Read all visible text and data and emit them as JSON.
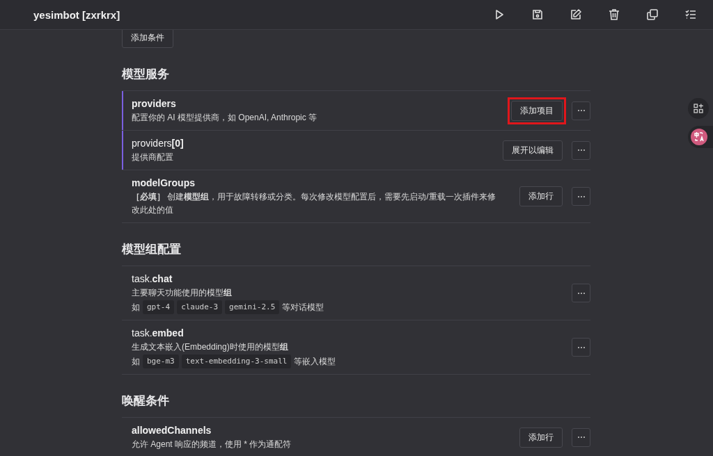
{
  "header": {
    "title": "yesimbot [zxrkrx]"
  },
  "top_button": "添加条件",
  "sections": [
    {
      "title": "模型服务",
      "rows": [
        {
          "name": "**providers**",
          "description": "配置你的 AI 模型提供商，如 OpenAI, Anthropic 等",
          "accent": true,
          "action": "添加项目",
          "highlighted": true
        },
        {
          "name": "providers**[0]**",
          "description": "提供商配置",
          "accent": true,
          "action": "展开以编辑",
          "highlighted": false
        },
        {
          "name": "**modelGroups**",
          "description": "**［必填］** 创建**模型组**，用于故障转移或分类。每次修改模型配置后，需要先启动/重载一次插件来修改此处的值",
          "accent": false,
          "action": "添加行",
          "highlighted": false
        }
      ]
    },
    {
      "title": "模型组配置",
      "rows": [
        {
          "name": "task.**chat**",
          "description": "主要聊天功能使用的模型**组**",
          "accent": false,
          "examples": {
            "prefix": "如",
            "codes": [
              "gpt-4",
              "claude-3",
              "gemini-2.5"
            ],
            "suffix": "等对话模型"
          }
        },
        {
          "name": "task.**embed**",
          "description": "生成文本嵌入(Embedding)时使用的模型**组**",
          "accent": false,
          "examples": {
            "prefix": "如",
            "codes": [
              "bge-m3",
              "text-embedding-3-small"
            ],
            "suffix": "等嵌入模型"
          }
        }
      ]
    },
    {
      "title": "唤醒条件",
      "rows": [
        {
          "name": "**allowedChannels**",
          "description": "允许 Agent 响应的频道，使用 * 作为通配符",
          "accent": false,
          "action": "添加行",
          "highlighted": false
        }
      ]
    }
  ]
}
